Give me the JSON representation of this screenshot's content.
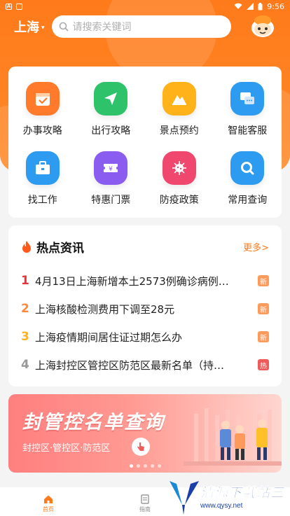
{
  "status": {
    "time": "9:56",
    "left_icon_a": "A"
  },
  "header": {
    "city": "上海",
    "search_placeholder": "请搜索关键词"
  },
  "services": [
    {
      "label": "办事攻略",
      "icon": "calendar-check-icon",
      "color": "#ff7a2a"
    },
    {
      "label": "出行攻略",
      "icon": "send-arrow-icon",
      "color": "#2ec26a"
    },
    {
      "label": "景点预约",
      "icon": "mountain-icon",
      "color": "#ffb21a"
    },
    {
      "label": "智能客服",
      "icon": "chat-icon",
      "color": "#2d9bf0"
    },
    {
      "label": "找工作",
      "icon": "briefcase-icon",
      "color": "#2d9bf0"
    },
    {
      "label": "特惠门票",
      "icon": "ticket-icon",
      "color": "#8a5cf0"
    },
    {
      "label": "防疫政策",
      "icon": "virus-icon",
      "color": "#f0476e"
    },
    {
      "label": "常用查询",
      "icon": "search-icon",
      "color": "#2d9bf0"
    }
  ],
  "news": {
    "title": "热点资讯",
    "more": "更多>",
    "items": [
      {
        "rank": "1",
        "text": "4月13日上海新增本土2573例确诊病例…",
        "tag": "新",
        "rank_color": "#e8333a",
        "tag_color": "#ff9a5a"
      },
      {
        "rank": "2",
        "text": "上海核酸检测费用下调至28元",
        "tag": "新",
        "rank_color": "#ff8a3a",
        "tag_color": "#ff9a5a"
      },
      {
        "rank": "3",
        "text": "上海疫情期间居住证过期怎么办",
        "tag": "新",
        "rank_color": "#ffb21a",
        "tag_color": "#ff9a5a"
      },
      {
        "rank": "4",
        "text": "上海封控区管控区防范区最新名单（持…",
        "tag": "热",
        "rank_color": "#999999",
        "tag_color": "#f05a5a"
      }
    ]
  },
  "banner": {
    "title": "封管控名单查询",
    "subtitle": "封控区·管控区·防范区"
  },
  "tabs": [
    {
      "label": "首页",
      "icon": "home-icon"
    },
    {
      "label": "指南",
      "icon": "document-icon"
    },
    {
      "label": "",
      "icon": "user-icon"
    }
  ],
  "watermark": {
    "text": "清源下载站三",
    "url": "www.qysy.net"
  }
}
